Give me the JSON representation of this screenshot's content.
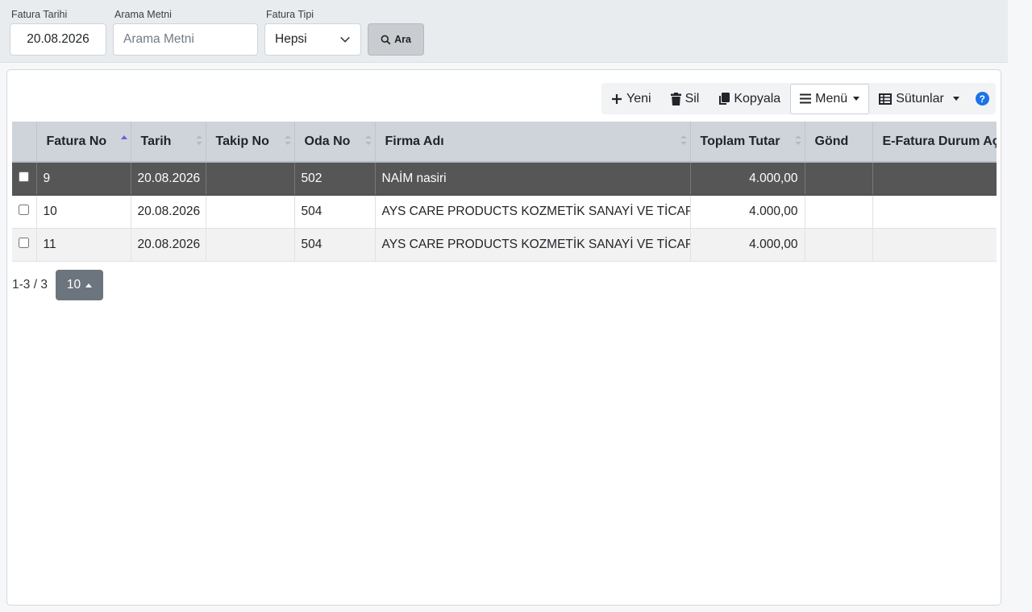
{
  "filters": {
    "fatura_tarihi": {
      "label": "Fatura Tarihi",
      "value": "20.08.2026"
    },
    "arama_metni": {
      "label": "Arama Metni",
      "placeholder": "Arama Metni"
    },
    "fatura_tipi": {
      "label": "Fatura Tipi",
      "value": "Hepsi"
    },
    "search_button": {
      "label": "Ara",
      "icon": "search-icon"
    }
  },
  "toolbar": {
    "new": "Yeni",
    "delete": "Sil",
    "copy": "Kopyala",
    "menu": "Menü",
    "columns": "Sütunlar",
    "help": "?"
  },
  "table": {
    "columns": [
      "Fatura No",
      "Tarih",
      "Takip No",
      "Oda No",
      "Firma Adı",
      "Toplam Tutar",
      "Gönd",
      "E-Fatura Durum Açıklama"
    ],
    "rows": [
      {
        "fatura_no": "9",
        "tarih": "20.08.2026",
        "takip_no": "",
        "oda_no": "502",
        "firma_adi": "NAİM nasiri",
        "toplam_tutar": "4.000,00",
        "gond": "",
        "efatura": "",
        "selected": true
      },
      {
        "fatura_no": "10",
        "tarih": "20.08.2026",
        "takip_no": "",
        "oda_no": "504",
        "firma_adi": "AYS CARE PRODUCTS KOZMETİK SANAYİ VE TİCARET",
        "toplam_tutar": "4.000,00",
        "gond": "",
        "efatura": "",
        "selected": false
      },
      {
        "fatura_no": "11",
        "tarih": "20.08.2026",
        "takip_no": "",
        "oda_no": "504",
        "firma_adi": "AYS CARE PRODUCTS KOZMETİK SANAYİ VE TİCARET",
        "toplam_tutar": "4.000,00",
        "gond": "",
        "efatura": "",
        "selected": false
      }
    ]
  },
  "pagination": {
    "info": "1-3 / 3",
    "page_size": "10"
  },
  "colors": {
    "accent": "#1a73e8",
    "selected_row": "#565656",
    "header_bg": "#cfd4da",
    "pager_button": "#6c757d"
  }
}
